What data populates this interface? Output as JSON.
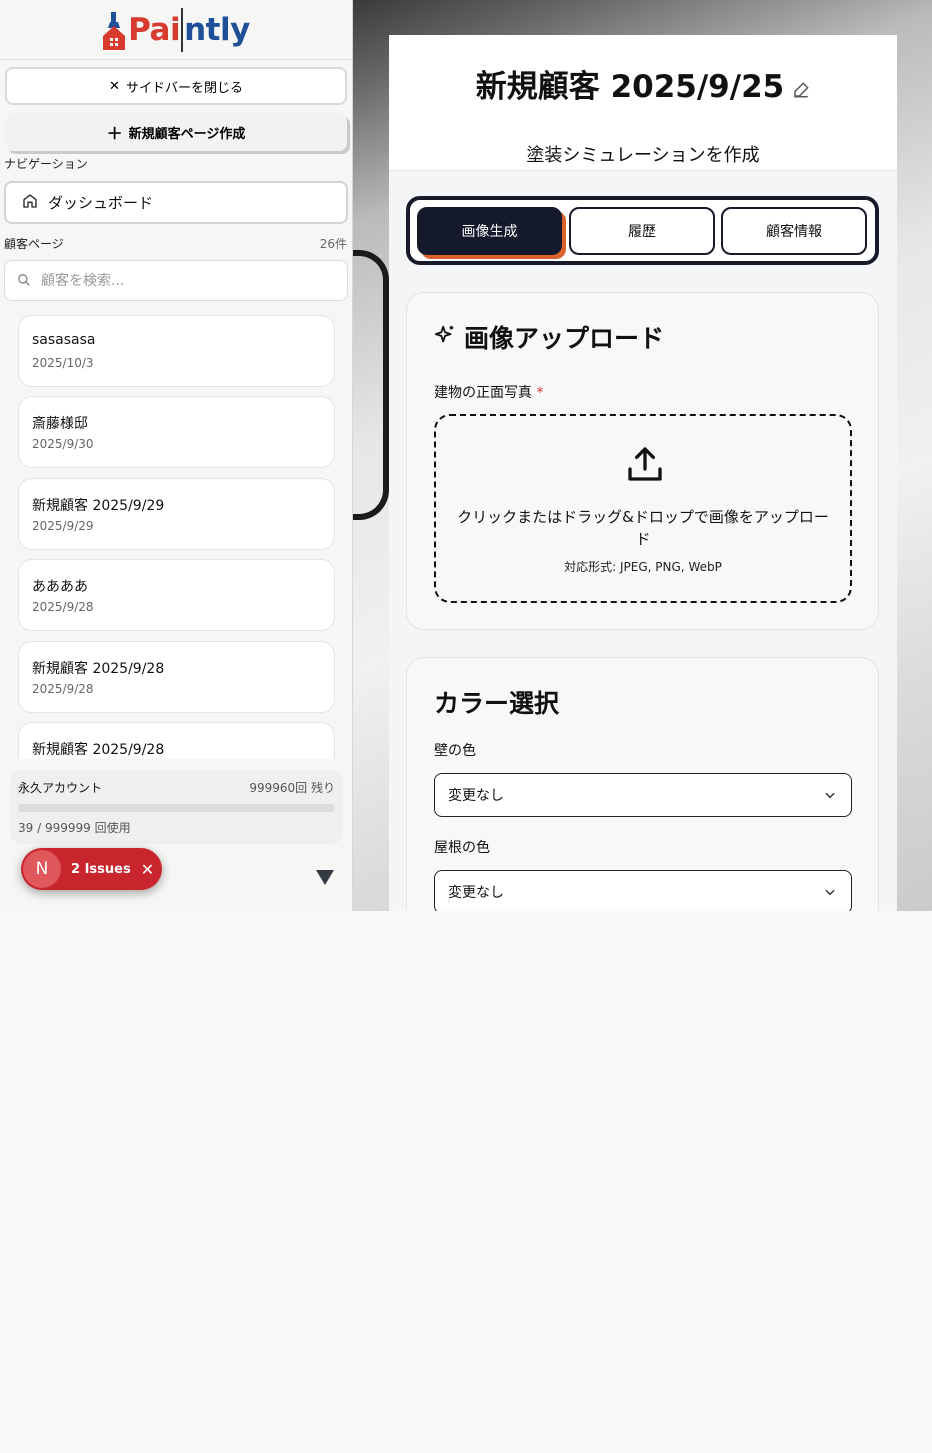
{
  "sidebar": {
    "logo_part1": "Pai",
    "logo_part2": "ntly",
    "close_label": "サイドバーを閉じる",
    "new_page_label": "新規顧客ページ作成",
    "nav_section": "ナビゲーション",
    "dashboard_label": "ダッシュボード",
    "customers_section": "顧客ページ",
    "customers_count": "26件",
    "search_placeholder": "顧客を検索...",
    "customers": [
      {
        "name": "sasasasa",
        "date": "2025/10/3"
      },
      {
        "name": "斎藤様邸",
        "date": "2025/9/30"
      },
      {
        "name": "新規顧客 2025/9/29",
        "date": "2025/9/29"
      },
      {
        "name": "ああああ",
        "date": "2025/9/28"
      },
      {
        "name": "新規顧客 2025/9/28",
        "date": "2025/9/28"
      },
      {
        "name": "新規顧客 2025/9/28",
        "date": ""
      }
    ],
    "usage": {
      "account_label": "永久アカウント",
      "remaining": "999960回 残り",
      "used_text": "39 / 999999 回使用",
      "used_fraction": 4e-05
    },
    "issues_badge": {
      "letter": "N",
      "label": "2 Issues"
    }
  },
  "main": {
    "title": "新規顧客 2025/9/25",
    "subtitle": "塗装シミュレーションを作成",
    "tabs": [
      {
        "label": "画像生成",
        "active": true
      },
      {
        "label": "履歴",
        "active": false
      },
      {
        "label": "顧客情報",
        "active": false
      }
    ],
    "upload": {
      "title": "画像アップロード",
      "field_label": "建物の正面写真",
      "required_mark": "*",
      "message": "クリックまたはドラッグ&ドロップで画像をアップロード",
      "formats": "対応形式: JPEG, PNG, WebP"
    },
    "colors": {
      "title": "カラー選択",
      "wall_label": "壁の色",
      "wall_value": "変更なし",
      "roof_label": "屋根の色",
      "roof_value": "変更なし"
    }
  },
  "colors": {
    "accent_dark": "#141a2b",
    "accent_orange": "#d9622c",
    "logo_red": "#d63b2e",
    "logo_blue": "#1f4f96",
    "issues_red": "#c9252c"
  }
}
